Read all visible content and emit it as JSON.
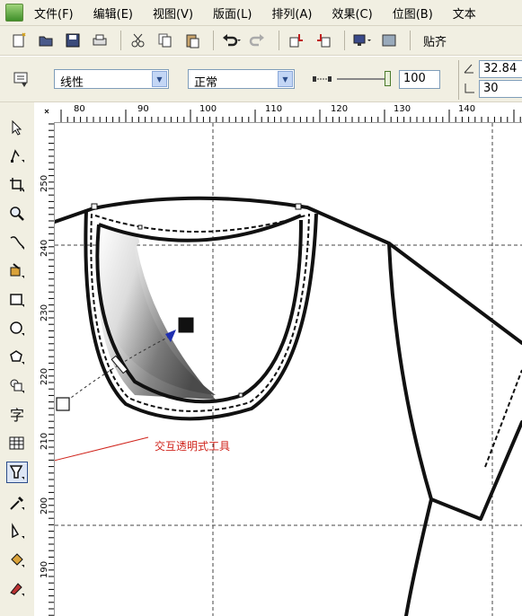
{
  "menu": {
    "items": [
      "文件(F)",
      "编辑(E)",
      "视图(V)",
      "版面(L)",
      "排列(A)",
      "效果(C)",
      "位图(B)",
      "文本"
    ]
  },
  "toolbar": {
    "snap_label": "贴齐"
  },
  "property_bar": {
    "transparency_type": "线性",
    "merge_mode": "正常",
    "opacity_value": "100",
    "angle_value": "32.84",
    "edge_value": "30"
  },
  "rulers": {
    "horizontal_ticks": [
      "80",
      "90",
      "100",
      "110",
      "120",
      "130",
      "140"
    ],
    "vertical_ticks": [
      "250",
      "240",
      "230",
      "220",
      "210",
      "200",
      "190"
    ]
  },
  "annotation": {
    "text": "交互透明式工具"
  },
  "colors": {
    "chrome": "#f1efe2",
    "annotation_red": "#d0251d",
    "handle_blue": "#1f2fb0"
  }
}
